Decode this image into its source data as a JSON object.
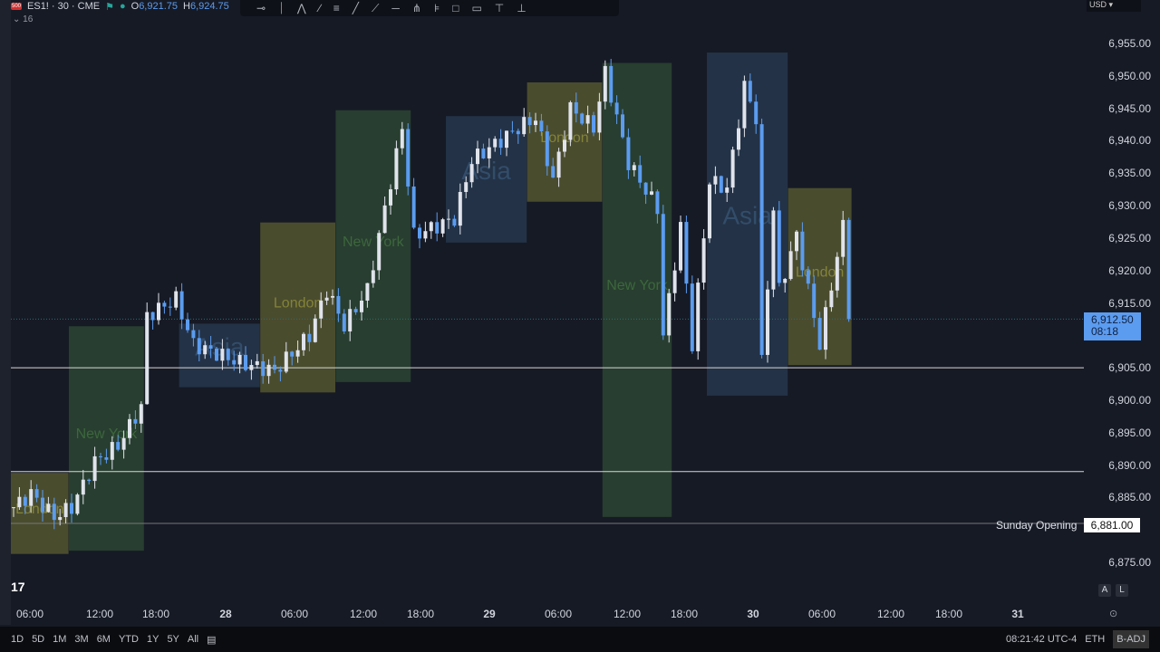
{
  "header": {
    "symbol_badge": "500",
    "symbol": "ES1! · 30 · CME",
    "open_label": "O",
    "open": "6,921.75",
    "high_label": "H",
    "high": "6,924.75",
    "indicator_count": "16",
    "currency": "USD"
  },
  "toolbar_icons": [
    "horizontal-ray-icon",
    "vertical-line-icon",
    "path-icon",
    "brush-icon",
    "parallel-channel-icon",
    "trend-line-icon",
    "ray-icon",
    "horizontal-line-icon",
    "pitchfork-icon",
    "fib-icon",
    "rectangle-icon",
    "callout-icon",
    "vertical-marker-icon",
    "anchor-icon"
  ],
  "price_axis": {
    "labels": [
      "6,955.00",
      "6,950.00",
      "6,945.00",
      "6,940.00",
      "6,935.00",
      "6,930.00",
      "6,925.00",
      "6,920.00",
      "6,915.00",
      "6,905.00",
      "6,900.00",
      "6,895.00",
      "6,890.00",
      "6,885.00",
      "6,875.00"
    ],
    "values": [
      6955,
      6950,
      6945,
      6940,
      6935,
      6930,
      6925,
      6920,
      6915,
      6905,
      6900,
      6895,
      6890,
      6885,
      6875
    ]
  },
  "current_price": {
    "price": "6,912.50",
    "countdown": "08:18",
    "value": 6912.5
  },
  "sunday_opening": {
    "label": "Sunday Opening",
    "price": "6,881.00",
    "value": 6881
  },
  "levels": [
    6905,
    6889
  ],
  "time_axis": [
    "06:00",
    "12:00",
    "18:00",
    "28",
    "06:00",
    "12:00",
    "18:00",
    "29",
    "06:00",
    "12:00",
    "18:00",
    "30",
    "06:00",
    "12:00",
    "18:00",
    "31"
  ],
  "colors": {
    "up": "#e0e3eb",
    "down": "#5b9cf0",
    "london": "#8a8a3a",
    "newyork": "#3e6b3e",
    "asia": "#34506e"
  },
  "chart_data": {
    "type": "candlestick",
    "interval": "30m",
    "bars": 145,
    "waypoints": [
      [
        0,
        6883.5
      ],
      [
        3,
        6885.6
      ],
      [
        7,
        6882
      ],
      [
        10,
        6883.5
      ],
      [
        14,
        6890.5
      ],
      [
        18,
        6893
      ],
      [
        22,
        6899
      ],
      [
        23,
        6913
      ],
      [
        28,
        6915.6
      ],
      [
        31,
        6908.6
      ],
      [
        39,
        6905.8
      ],
      [
        45,
        6904.5
      ],
      [
        51,
        6910
      ],
      [
        54,
        6917
      ],
      [
        57,
        6911.5
      ],
      [
        61,
        6917
      ],
      [
        67,
        6942
      ],
      [
        69,
        6925.4
      ],
      [
        76,
        6928
      ],
      [
        79,
        6937
      ],
      [
        87,
        6942
      ],
      [
        90,
        6943.5
      ],
      [
        93,
        6934
      ],
      [
        96,
        6945
      ],
      [
        100,
        6942
      ],
      [
        102,
        6950.5
      ],
      [
        106,
        6936.6
      ],
      [
        111,
        6929.6
      ],
      [
        112,
        6910
      ],
      [
        115,
        6926.8
      ],
      [
        117,
        6908.6
      ],
      [
        120,
        6933.8
      ],
      [
        123,
        6932.6
      ],
      [
        126,
        6948.4
      ],
      [
        128,
        6943.5
      ],
      [
        129,
        6905.8
      ],
      [
        131,
        6929.6
      ],
      [
        132,
        6917
      ],
      [
        135,
        6925.4
      ],
      [
        139,
        6908.6
      ],
      [
        143,
        6926.8
      ],
      [
        144,
        6912.5
      ]
    ],
    "sessions": [
      {
        "label": "London",
        "kind": "london",
        "start": 0,
        "end": 9,
        "high": 6888.8,
        "low": 6876.3
      },
      {
        "label": "New York",
        "kind": "newyork",
        "start": 10,
        "end": 22,
        "high": 6911.4,
        "low": 6876.8
      },
      {
        "label": "Asia",
        "kind": "asia",
        "start": 29,
        "end": 42,
        "high": 6911.8,
        "low": 6902
      },
      {
        "label": "London",
        "kind": "london",
        "start": 43,
        "end": 55,
        "high": 6927.4,
        "low": 6901.2
      },
      {
        "label": "New York",
        "kind": "newyork",
        "start": 56,
        "end": 68,
        "high": 6944.7,
        "low": 6902.8
      },
      {
        "label": "Asia",
        "kind": "asia",
        "start": 75,
        "end": 88,
        "high": 6943.8,
        "low": 6924.3
      },
      {
        "label": "London",
        "kind": "london",
        "start": 89,
        "end": 101,
        "high": 6949,
        "low": 6930.6
      },
      {
        "label": "New York",
        "kind": "newyork",
        "start": 102,
        "end": 113,
        "high": 6952,
        "low": 6882
      },
      {
        "label": "Asia",
        "kind": "asia",
        "start": 120,
        "end": 133,
        "high": 6953.6,
        "low": 6900.7
      },
      {
        "label": "London",
        "kind": "london",
        "start": 134,
        "end": 144,
        "high": 6932.7,
        "low": 6905.4
      }
    ]
  },
  "bottom": {
    "ranges": [
      "1D",
      "5D",
      "1M",
      "3M",
      "6M",
      "YTD",
      "1Y",
      "5Y",
      "All"
    ],
    "time": "08:21:42 UTC-4",
    "session": "ETH",
    "adj": "B-ADJ",
    "auto": "A",
    "log": "L"
  }
}
